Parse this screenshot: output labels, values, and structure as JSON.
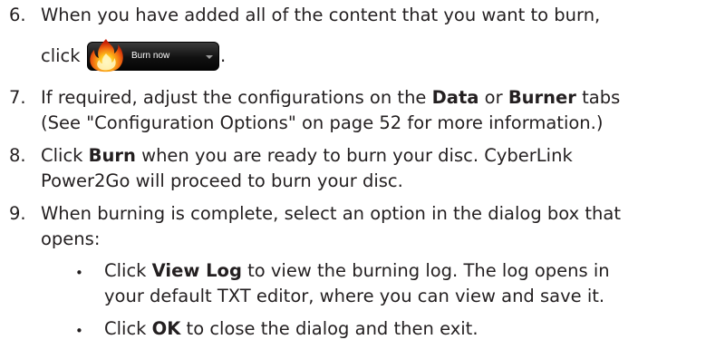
{
  "steps": [
    {
      "number": "6.",
      "line1": "When you have added all of the content that you want to burn,",
      "line2_prefix": "click",
      "line2_suffix": ".",
      "button": {
        "label": "Burn now",
        "icon": "flame-icon"
      }
    },
    {
      "number": "7.",
      "line1_a": "If required, adjust the configurations on the ",
      "line1_b": "Data",
      "line1_c": " or ",
      "line1_d": "Burner",
      "line1_e": " tabs",
      "line2": "(See \"Configuration Options\" on page 52 for more information.)"
    },
    {
      "number": "8.",
      "line1_a": "Click ",
      "line1_b": "Burn",
      "line1_c": " when you are ready to burn your disc. CyberLink",
      "line2": "Power2Go will proceed to burn your disc."
    },
    {
      "number": "9.",
      "line1": "When burning is complete, select an option in the dialog box that",
      "line2": "opens:",
      "bullets": [
        {
          "line1_a": "Click ",
          "line1_b": "View Log",
          "line1_c": " to view the burning log. The log opens in",
          "line2": "your default TXT editor, where you can view and save it."
        },
        {
          "line1_a": "Click ",
          "line1_b": "OK",
          "line1_c": " to close the dialog and then exit."
        }
      ]
    }
  ],
  "bullet_char": "•"
}
